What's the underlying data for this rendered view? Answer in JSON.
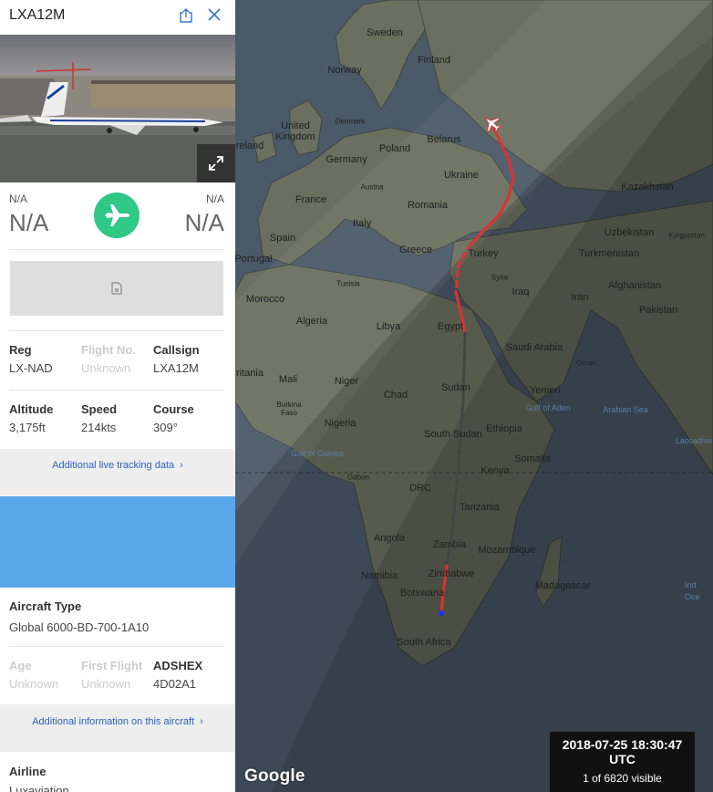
{
  "flight": {
    "callsign_title": "LXA12M",
    "origin": {
      "code": "N/A",
      "time": "N/A"
    },
    "destination": {
      "code": "N/A",
      "time": "N/A"
    },
    "reg_label": "Reg",
    "reg_value": "LX-NAD",
    "flightno_label": "Flight No.",
    "flightno_value": "Unknown",
    "callsign_label": "Callsign",
    "callsign_value": "LXA12M",
    "altitude_label": "Altitude",
    "altitude_value": "3,175ft",
    "speed_label": "Speed",
    "speed_value": "214kts",
    "course_label": "Course",
    "course_value": "309°",
    "live_link": "Additional live tracking data",
    "type_label": "Aircraft Type",
    "type_value": "Global 6000-BD-700-1A10",
    "age_label": "Age",
    "age_value": "Unknown",
    "firstflight_label": "First Flight",
    "firstflight_value": "Unknown",
    "adshex_label": "ADSHEX",
    "adshex_value": "4D02A1",
    "aircraft_link": "Additional information on this aircraft",
    "airline_label": "Airline",
    "airline_value": "Luxaviation"
  },
  "map": {
    "google_label": "Google",
    "timestamp": "2018-07-25 18:30:47 UTC",
    "visible": "1 of 6820 visible",
    "labels": {
      "sweden": "Sweden",
      "finland": "Finland",
      "norway": "Norway",
      "denmark": "Denmark",
      "uk": "United Kingdom",
      "ireland": "reland",
      "belarus": "Belarus",
      "poland": "Poland",
      "germany": "Germany",
      "ukraine": "Ukraine",
      "austria": "Austria",
      "france": "France",
      "romania": "Romania",
      "kazakhstan": "Kazakhstan",
      "italy": "Italy",
      "uzbekistan": "Uzbekistan",
      "kyrgyzstan": "Kyrgyzstan",
      "spain": "Spain",
      "greece": "Greece",
      "turkey": "Turkey",
      "turkmenistan": "Turkmenistan",
      "portugal": "Portugal",
      "tunisia": "Tunisia",
      "syria": "Syria",
      "iraq": "Iraq",
      "iran": "Iran",
      "afghanistan": "Afghanistan",
      "morocco": "Morocco",
      "pakistan": "Pakistan",
      "algeria": "Algeria",
      "libya": "Libya",
      "egypt": "Egypt",
      "saudi": "Saudi Arabia",
      "oman": "Oman",
      "mauritania": "ritania",
      "mali": "Mali",
      "niger": "Niger",
      "sudan": "Sudan",
      "yemen": "Yemen",
      "gulf_aden": "Gulf of Aden",
      "arabian_sea": "Arabian Sea",
      "chad": "Chad",
      "burkina": "Burkina Faso",
      "nigeria": "Nigeria",
      "south_sudan": "South Sudan",
      "ethiopia": "Ethiopia",
      "laccadive": "Laccadive",
      "gulf_guinea": "Gulf of Guinea",
      "somalia": "Somalia",
      "gabon": "Gabon",
      "kenya": "Kenya",
      "drc": "DRC",
      "tanzania": "Tanzania",
      "angola": "Angola",
      "zambia": "Zambia",
      "mozambique": "Mozambique",
      "madagascar": "Madagascar",
      "namibia": "Namibia",
      "zimbabwe": "Zimbabwe",
      "botswana": "Botswana",
      "south_africa": "South Africa",
      "indian_ocean": "Ind Oce"
    }
  },
  "colors": {
    "green": "#2fc885",
    "blue_band": "#5aa8ea",
    "link": "#2a62b8",
    "track_red": "#e03030"
  }
}
